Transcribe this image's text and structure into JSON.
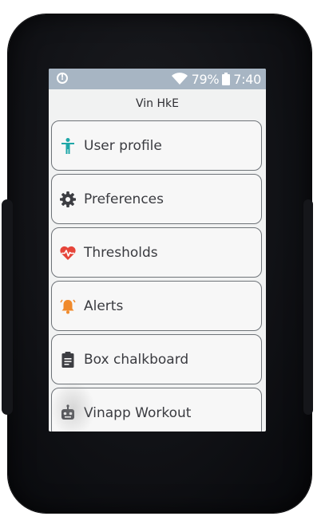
{
  "status_bar": {
    "alert_icon": "info-circle-icon",
    "wifi_icon": "wifi-icon",
    "battery_percent": "79%",
    "battery_icon": "battery-icon",
    "time": "7:40"
  },
  "screen": {
    "title": "Vin HkE"
  },
  "menu": {
    "items": [
      {
        "label": "User profile",
        "icon": "person-icon",
        "icon_color": "#1fa7a8"
      },
      {
        "label": "Preferences",
        "icon": "gear-icon",
        "icon_color": "#3c3d42"
      },
      {
        "label": "Thresholds",
        "icon": "heart-pulse-icon",
        "icon_color": "#e6453a"
      },
      {
        "label": "Alerts",
        "icon": "bell-icon",
        "icon_color": "#f08a2b"
      },
      {
        "label": "Box chalkboard",
        "icon": "clipboard-icon",
        "icon_color": "#3c3d42"
      },
      {
        "label": "Vinapp Workout",
        "icon": "robot-icon",
        "icon_color": "#4a4b50"
      }
    ]
  },
  "colors": {
    "status_bar_bg": "#a7b5c3",
    "screen_bg": "#f1f2f2",
    "item_border": "#6e7378",
    "bezel": "#111216"
  }
}
